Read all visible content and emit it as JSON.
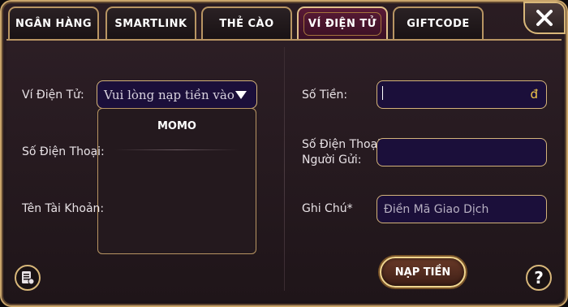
{
  "tabs": [
    {
      "label": "NGÂN HÀNG",
      "active": false
    },
    {
      "label": "SMARTLINK",
      "active": false
    },
    {
      "label": "THẺ CÀO",
      "active": false
    },
    {
      "label": "VÍ ĐIỆN TỬ",
      "active": true
    },
    {
      "label": "GIFTCODE",
      "active": false
    }
  ],
  "left": {
    "wallet_label": "Ví Điện Tử:",
    "wallet_select_value": "Vui lòng nạp tiền vào",
    "dropdown_options": [
      "MOMO"
    ],
    "phone_label": "Số Điện Thoại:",
    "account_label": "Tên Tài Khoản:"
  },
  "right": {
    "amount_label": "Số Tiền:",
    "currency_symbol": "đ",
    "sender_phone_label_line1": "Số Điện Thoại",
    "sender_phone_label_line2": "Người Gửi:",
    "note_label": "Ghi Chú*",
    "note_placeholder": "Điền Mã Giao Dịch",
    "submit_label": "NẠP TIỀN"
  },
  "icons": {
    "close": "close-icon",
    "history": "history-icon",
    "help": "help-icon",
    "help_glyph": "?"
  },
  "colors": {
    "accent_gold": "#d3b37a",
    "active_tab": "#5a1a36",
    "input_bg": "#1b0f3a",
    "currency": "#f3c84a"
  }
}
